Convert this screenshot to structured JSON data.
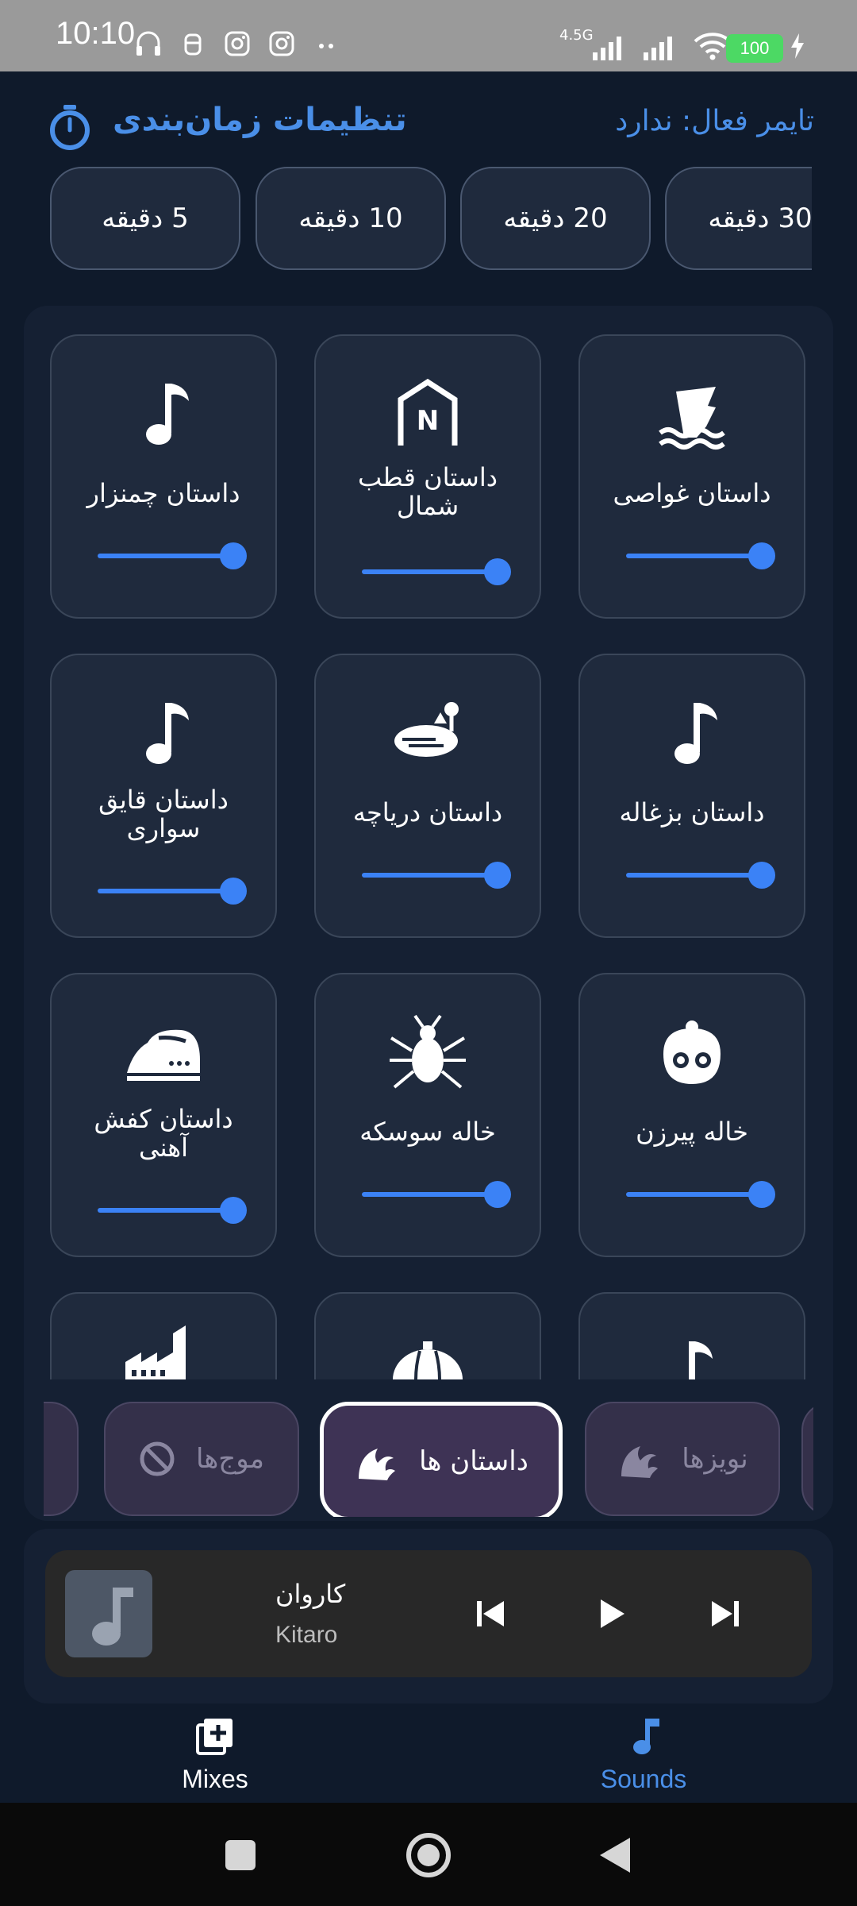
{
  "status_bar": {
    "time": "10:10",
    "network": "4.5G",
    "battery": "100",
    "icons": [
      "headphones-icon",
      "secure-icon",
      "instagram-icon",
      "instagram-icon",
      "more-icon"
    ]
  },
  "timer": {
    "title": "تنظیمات زمان‌بندی",
    "active_timer": "تایمر فعال: ندارد",
    "presets": [
      "30 دقیقه",
      "20 دقیقه",
      "10 دقیقه",
      "5 دقیقه"
    ]
  },
  "sounds": [
    {
      "label": "داستان غواصی",
      "icon": "diver-icon",
      "volume": 1.0
    },
    {
      "label": "داستان قطب شمال",
      "icon": "north-pole-icon",
      "volume": 1.0
    },
    {
      "label": "داستان چمنزار",
      "icon": "music-note-icon",
      "volume": 1.0
    },
    {
      "label": "داستان بزغاله",
      "icon": "music-note-icon",
      "volume": 1.0
    },
    {
      "label": "داستان دریاچه",
      "icon": "lake-icon",
      "volume": 1.0
    },
    {
      "label": "داستان قایق سواری",
      "icon": "music-note-icon",
      "volume": 1.0
    },
    {
      "label": "خاله پیرزن",
      "icon": "old-woman-icon",
      "volume": 1.0
    },
    {
      "label": "خاله سوسکه",
      "icon": "bug-icon",
      "volume": 1.0
    },
    {
      "label": "داستان کفش آهنی",
      "icon": "iron-icon",
      "volume": 1.0
    }
  ],
  "categories": [
    {
      "label": "نویزها",
      "icon": "wave-icon",
      "active": false
    },
    {
      "label": "داستان ها",
      "icon": "wave-icon",
      "active": true
    },
    {
      "label": "موج‌ها",
      "icon": "block-icon",
      "active": false
    }
  ],
  "player": {
    "title": "کاروان",
    "artist": "Kitaro",
    "controls": [
      "skip-previous-icon",
      "play-icon",
      "skip-next-icon"
    ]
  },
  "bottom_nav": {
    "mixes": "Mixes",
    "sounds": "Sounds",
    "active_color": "#4a8fe8"
  }
}
